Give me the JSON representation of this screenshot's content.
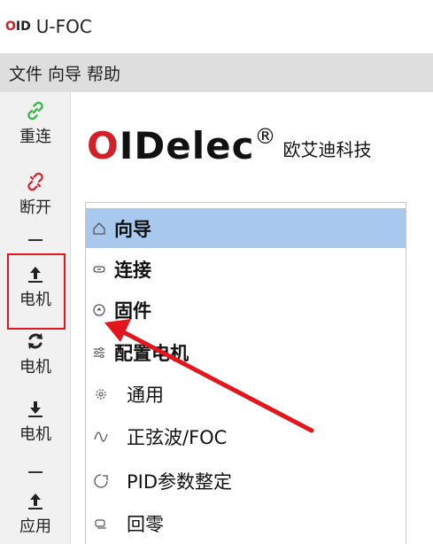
{
  "window": {
    "logo": "OID",
    "title": "U-FOC"
  },
  "menubar": {
    "items": [
      "文件",
      "向导",
      "帮助"
    ]
  },
  "toolbar": {
    "reconnect_label": "重连",
    "disconnect_label": "断开",
    "upload_motor_label": "电机",
    "sync_motor_label": "电机",
    "download_motor_label": "电机",
    "upload_app_label": "应用"
  },
  "brand": {
    "logo": "OIDelec",
    "registered": "®",
    "company": "欧艾迪科技"
  },
  "nav": {
    "items": [
      {
        "label": "向导",
        "icon": "home-icon",
        "selected": true
      },
      {
        "label": "连接",
        "icon": "link-icon"
      },
      {
        "label": "固件",
        "icon": "firmware-icon"
      },
      {
        "label": "配置电机",
        "icon": "settings-sliders-icon"
      },
      {
        "label": "通用",
        "icon": "gear-icon"
      },
      {
        "label": "正弦波/FOC",
        "icon": "sine-wave-icon"
      },
      {
        "label": "PID参数整定",
        "icon": "pid-icon"
      },
      {
        "label": "回零",
        "icon": "homing-icon"
      }
    ]
  },
  "colors": {
    "accent_red": "#d0202a",
    "selection": "#a9c8ee",
    "link_green": "#3fb54a",
    "annotation_red": "#e2161c"
  }
}
